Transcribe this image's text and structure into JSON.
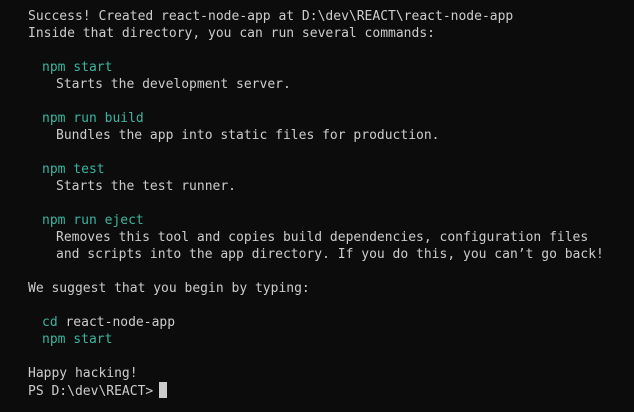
{
  "terminal": {
    "success_line": "Success! Created react-node-app at D:\\dev\\REACT\\react-node-app",
    "inside_line": "Inside that directory, you can run several commands:",
    "commands": [
      {
        "cmd": "npm start",
        "desc": [
          "Starts the development server."
        ]
      },
      {
        "cmd": "npm run build",
        "desc": [
          "Bundles the app into static files for production."
        ]
      },
      {
        "cmd": "npm test",
        "desc": [
          "Starts the test runner."
        ]
      },
      {
        "cmd": "npm run eject",
        "desc": [
          "Removes this tool and copies build dependencies, configuration files",
          "and scripts into the app directory. If you do this, you can’t go back!"
        ]
      }
    ],
    "suggest_line": "We suggest that you begin by typing:",
    "suggest_cd_keyword": "cd",
    "suggest_cd_arg": " react-node-app",
    "suggest_start": "npm start",
    "happy_line": "Happy hacking!",
    "prompt": "PS D:\\dev\\REACT>"
  },
  "colors": {
    "background": "#0c0c0c",
    "text": "#cccccc",
    "command": "#3ab4a0"
  }
}
